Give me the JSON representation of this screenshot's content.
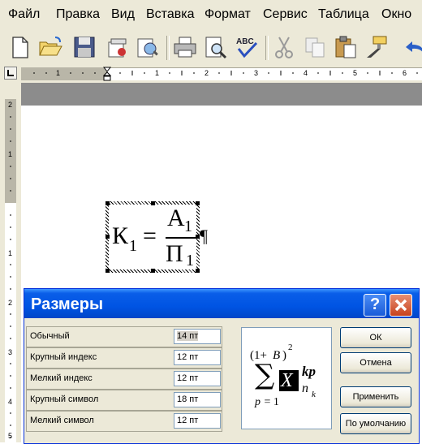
{
  "menu": {
    "file": "Файл",
    "edit": "Правка",
    "view": "Вид",
    "insert": "Вставка",
    "format": "Формат",
    "service": "Сервис",
    "table": "Таблица",
    "window": "Окно"
  },
  "hruler_numbers": [
    "1",
    "1",
    "2",
    "3",
    "4",
    "5",
    "6"
  ],
  "vruler_numbers": [
    "2",
    "1",
    "1",
    "2",
    "3",
    "4",
    "5"
  ],
  "formula": {
    "lhs": "К",
    "lhs_sub": "1",
    "eq": "=",
    "num": "А",
    "num_sub": "1",
    "den": "П",
    "den_sub": "1",
    "pilcrow": "¶"
  },
  "dialog": {
    "title": "Размеры",
    "help": "?",
    "rows": [
      {
        "label": "Обычный",
        "value": "14 пт"
      },
      {
        "label": "Крупный индекс",
        "value": "12 пт"
      },
      {
        "label": "Мелкий индекс",
        "value": "12 пт"
      },
      {
        "label": "Крупный символ",
        "value": "18 пт"
      },
      {
        "label": "Мелкий символ",
        "value": "12 пт"
      }
    ],
    "buttons": {
      "ok": "ОК",
      "cancel": "Отмена",
      "apply": "Применить",
      "default": "По умолчанию"
    },
    "preview": {
      "paren_open": "(1+",
      "paren_var": "B",
      "paren_close": ")",
      "paren_exp": "2",
      "sum": "∑",
      "var": "X",
      "sup": "kp",
      "sub_n": "n",
      "sub_k": "k",
      "lower": "p",
      "lower_eq": " = 1"
    }
  }
}
